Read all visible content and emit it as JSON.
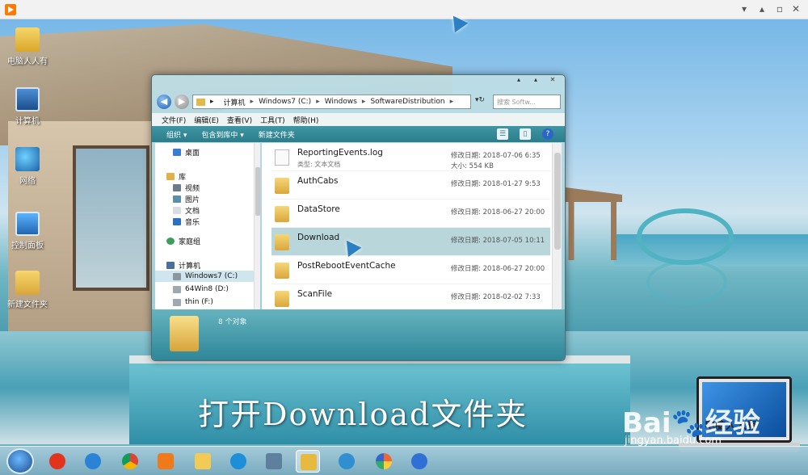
{
  "desktop_icons": [
    {
      "label": "电脑人人有",
      "icon": "folder-user-icon"
    },
    {
      "label": "计算机",
      "icon": "computer-icon"
    },
    {
      "label": "网络",
      "icon": "network-icon"
    },
    {
      "label": "控制面板",
      "icon": "control-panel-icon"
    },
    {
      "label": "新建文件夹",
      "icon": "folder-icon"
    }
  ],
  "address": {
    "segments": [
      "计算机",
      "Windows7 (C:)",
      "Windows",
      "SoftwareDistribution"
    ],
    "search_placeholder": "搜索 Softw..."
  },
  "menu": [
    "文件(F)",
    "编辑(E)",
    "查看(V)",
    "工具(T)",
    "帮助(H)"
  ],
  "commands": [
    "组织 ▾",
    "包含到库中 ▾",
    "新建文件夹"
  ],
  "nav_pane": [
    {
      "label": "桌面",
      "icon": "desktop-icon"
    },
    {
      "label": "库",
      "icon": "library-icon"
    },
    {
      "label": "视频",
      "icon": "video-icon"
    },
    {
      "label": "图片",
      "icon": "picture-icon"
    },
    {
      "label": "文档",
      "icon": "document-icon"
    },
    {
      "label": "音乐",
      "icon": "music-icon"
    },
    {
      "label": "家庭组",
      "icon": "homegroup-icon"
    },
    {
      "label": "计算机",
      "icon": "computer-icon"
    },
    {
      "label": "Windows7 (C:)",
      "icon": "drive-icon"
    },
    {
      "label": "64Win8 (D:)",
      "icon": "drive-icon"
    },
    {
      "label": "thin (F:)",
      "icon": "drive-icon"
    }
  ],
  "files": [
    {
      "name": "ReportingEvents.log",
      "date": "修改日期: 2018-07-06 6:35",
      "type": "类型: 文本文档",
      "size": "大小: 554 KB",
      "kind": "log"
    },
    {
      "name": "AuthCabs",
      "date": "修改日期: 2018-01-27 9:53",
      "kind": "folder"
    },
    {
      "name": "DataStore",
      "date": "修改日期: 2018-06-27 20:00",
      "kind": "folder"
    },
    {
      "name": "Download",
      "date": "修改日期: 2018-07-05 10:11",
      "kind": "folder",
      "selected": true
    },
    {
      "name": "PostRebootEventCache",
      "date": "修改日期: 2018-06-27 20:00",
      "kind": "folder"
    },
    {
      "name": "ScanFile",
      "date": "修改日期: 2018-02-02 7:33",
      "kind": "folder"
    }
  ],
  "details": {
    "count": "8 个对象"
  },
  "caption": "打开Download文件夹",
  "laptop_text": "电脑人人有",
  "watermark": {
    "brand": "Bai",
    "brand2": "经验",
    "url": "jingyan.baidu.com"
  },
  "taskbar_icons": [
    "start-icon",
    "app-red-icon",
    "ie-icon",
    "chrome-icon",
    "media-icon",
    "folder-yellow-icon",
    "browser-icon",
    "monitor-icon",
    "explorer-icon",
    "pinwheel-icon",
    "paint-icon",
    "settings-icon"
  ],
  "colors": {
    "accent": "#2c7d8b",
    "selection": "#b9d6da",
    "folder": "#e4b84a"
  }
}
